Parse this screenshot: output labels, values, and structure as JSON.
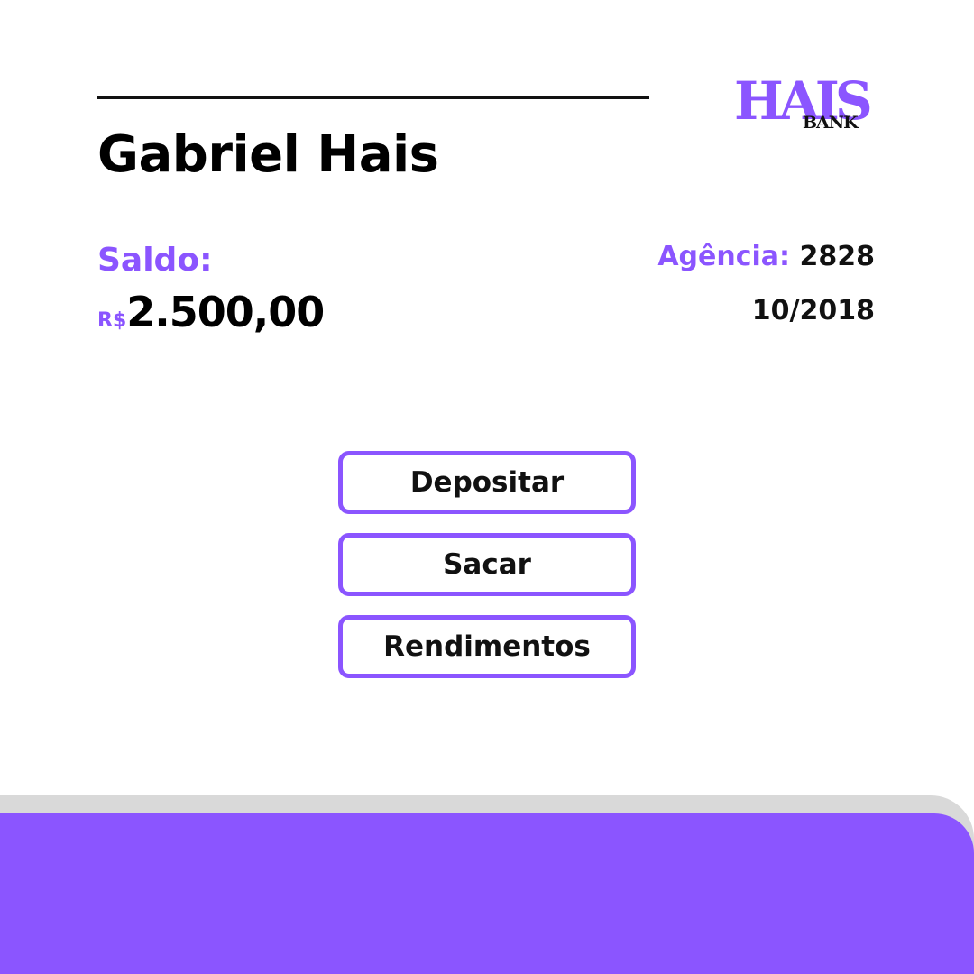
{
  "colors": {
    "accent": "#8b55ff",
    "text": "#000000",
    "background": "#ffffff",
    "footer_shadow": "#d9d9d9"
  },
  "brand": {
    "logo_main": "HAIS",
    "logo_sub": "BANK"
  },
  "user": {
    "name": "Gabriel Hais"
  },
  "account": {
    "balance_label": "Saldo:",
    "currency": "R$",
    "balance": "2.500,00",
    "agency_label": "Agência:",
    "agency_number": "2828",
    "account_number": "10/2018"
  },
  "actions": {
    "deposit_label": "Depositar",
    "withdraw_label": "Sacar",
    "earnings_label": "Rendimentos"
  }
}
